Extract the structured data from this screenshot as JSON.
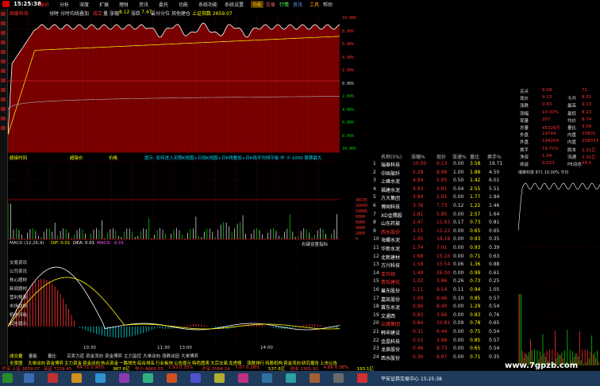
{
  "window": {
    "clock": "15:25:38"
  },
  "menu": [
    {
      "label": "报价",
      "active": true
    },
    {
      "label": "分析",
      "active": false
    },
    {
      "label": "深度",
      "active": false
    },
    {
      "label": "扩展",
      "active": false
    },
    {
      "label": "理财",
      "active": false
    },
    {
      "label": "资讯",
      "active": false
    },
    {
      "label": "委托",
      "active": false
    },
    {
      "label": "功能",
      "active": false
    },
    {
      "label": "系统功能",
      "active": false
    },
    {
      "label": "系统设置",
      "active": false
    }
  ],
  "sys_links": [
    {
      "label": "功能",
      "color": "#ffcc00"
    },
    {
      "label": "交易",
      "color": "#ff6060"
    },
    {
      "label": "行情",
      "color": "#60ff60"
    },
    {
      "label": "资讯",
      "color": "#60a0ff"
    },
    {
      "label": "工具",
      "color": "#ff9900"
    },
    {
      "label": "帮助",
      "color": "#cccccc"
    }
  ],
  "top_header": {
    "stock_name": "国泰科技",
    "fenshi": "分时",
    "tab1": "分时均线叠加",
    "price": "成交",
    "vol": "量",
    "chg": "涨幅",
    "index": "8.12",
    "zhangdie": "涨跌",
    "zd_val": "7.47",
    "state": "最分分位",
    "other": "其他建仓",
    "ref": "上证指数 2659.07"
  },
  "price_axis_right": [
    "10.00%",
    "8.00%",
    "6.00%",
    "4.00%",
    "2.00%",
    "0.00%",
    "2.00%",
    "4.00%",
    "6.00%",
    "8.00%",
    "10.00%"
  ],
  "indicator_header": {
    "a": "超级时间",
    "b": "超级价",
    "c": "价格",
    "d": "提示: 如何进入无限K线图+日线K线图+日K线叠加+日K线平均线平板 中 小 1000 股票最大"
  },
  "vol_axis": [
    "30135",
    "20099",
    "10066",
    "8000",
    "6000",
    "4000",
    "2000",
    "0"
  ],
  "macd_header": {
    "label": "MACD (12,26,9)",
    "dif": "DIF: 0.01",
    "dea": "DEA: 0.01",
    "macd": "MACD: -0.01"
  },
  "right_note": "右键设置指标",
  "left_labels": [
    "交易资讯",
    "公司资讯",
    "核心题材",
    "新闻题材",
    "营利预测",
    "市场结构",
    "机构评级",
    "公告提示"
  ],
  "time_axis": [
    "10:30",
    "11:30",
    "13:00",
    "14:00"
  ],
  "table": {
    "headers": [
      "名称(5%)",
      "涨幅%",
      "现价",
      "涨速%",
      "量比",
      "换手%"
    ],
    "rows": [
      {
        "no": "1",
        "name": "瑞泰科技",
        "chg": "10.00",
        "price": "9.13",
        "speed": "0.00",
        "ratio": "3.58",
        "turn": "19.71",
        "up": true
      },
      {
        "no": "2",
        "name": "中国玻纤",
        "chg": "5.28",
        "price": "8.98",
        "speed": "1.00",
        "ratio": "1.88",
        "turn": "4.50",
        "up": true
      },
      {
        "no": "3",
        "name": "上峰水泥",
        "chg": "4.94",
        "price": "5.95",
        "speed": "0.50",
        "ratio": "1.42",
        "turn": "6.01",
        "up": true
      },
      {
        "no": "4",
        "name": "福建水泥",
        "chg": "4.93",
        "price": "5.81",
        "speed": "0.04",
        "ratio": "2.55",
        "turn": "5.51",
        "up": true
      },
      {
        "no": "5",
        "name": "方大集团",
        "chg": "3.94",
        "price": "2.91",
        "speed": "0.00",
        "ratio": "1.77",
        "turn": "1.94",
        "up": true
      },
      {
        "no": "6",
        "name": "博闻科技",
        "chg": "3.76",
        "price": "7.73",
        "speed": "0.12",
        "ratio": "1.22",
        "turn": "1.46",
        "up": true
      },
      {
        "no": "7",
        "name": "XD金隅股",
        "chg": "2.81",
        "price": "5.85",
        "speed": "0.00",
        "ratio": "2.57",
        "turn": "1.64",
        "up": true
      },
      {
        "no": "8",
        "name": "山东药玻",
        "chg": "2.47",
        "price": "11.63",
        "speed": "0.17",
        "ratio": "0.73",
        "turn": "0.81",
        "up": true
      },
      {
        "no": "9",
        "name": "西水股份",
        "chg": "2.15",
        "price": "15.22",
        "speed": "0.00",
        "ratio": "0.65",
        "turn": "0.65",
        "up": true
      },
      {
        "no": "10",
        "name": "海螺水泥",
        "chg": "1.95",
        "price": "16.18",
        "speed": "0.00",
        "ratio": "0.93",
        "turn": "0.35",
        "up": true
      },
      {
        "no": "11",
        "name": "华新水泥",
        "chg": "1.74",
        "price": "7.01",
        "speed": "0.00",
        "ratio": "0.93",
        "turn": "0.39",
        "up": true
      },
      {
        "no": "12",
        "name": "北新建材",
        "chg": "1.68",
        "price": "15.16",
        "speed": "0.00",
        "ratio": "0.71",
        "turn": "0.63",
        "up": true
      },
      {
        "no": "13",
        "name": "方兴科技",
        "chg": "1.58",
        "price": "15.54",
        "speed": "0.06",
        "ratio": "1.36",
        "turn": "0.88",
        "up": true
      },
      {
        "no": "14",
        "name": "亚玛顿",
        "chg": "1.49",
        "price": "26.00",
        "speed": "0.00",
        "ratio": "0.99",
        "turn": "0.61",
        "up": true
      },
      {
        "no": "15",
        "name": "青松建化",
        "chg": "1.32",
        "price": "3.86",
        "speed": "0.26",
        "ratio": "0.73",
        "turn": "0.25",
        "up": true
      },
      {
        "no": "16",
        "name": "巢东股份",
        "chg": "1.11",
        "price": "9.14",
        "speed": "0.11",
        "ratio": "0.94",
        "turn": "1.05",
        "up": true
      },
      {
        "no": "17",
        "name": "嘉凯股份",
        "chg": "1.09",
        "price": "9.46",
        "speed": "0.10",
        "ratio": "0.85",
        "turn": "0.57",
        "up": true
      },
      {
        "no": "18",
        "name": "冀东水泥",
        "chg": "0.96",
        "price": "8.40",
        "speed": "0.00",
        "ratio": "1.29",
        "turn": "0.54",
        "up": true
      },
      {
        "no": "19",
        "name": "文通西",
        "chg": "0.83",
        "price": "3.66",
        "speed": "0.00",
        "ratio": "0.83",
        "turn": "0.76",
        "up": true
      },
      {
        "no": "20",
        "name": "尖峰集团",
        "chg": "0.84",
        "price": "10.81",
        "speed": "0.09",
        "ratio": "0.78",
        "turn": "0.65",
        "up": true
      },
      {
        "no": "21",
        "name": "韩申建设",
        "chg": "0.31",
        "price": "6.44",
        "speed": "0.00",
        "ratio": "0.75",
        "turn": "0.54",
        "up": true
      },
      {
        "no": "22",
        "name": "金晶科技",
        "chg": "0.51",
        "price": "3.98",
        "speed": "0.00",
        "ratio": "0.85",
        "turn": "0.57",
        "up": true
      },
      {
        "no": "23",
        "name": "龙泉股份",
        "chg": "0.46",
        "price": "8.73",
        "speed": "0.00",
        "ratio": "0.65",
        "turn": "0.54",
        "up": true
      },
      {
        "no": "24",
        "name": "西水股份",
        "chg": "0.36",
        "price": "6.97",
        "speed": "0.00",
        "ratio": "0.71",
        "turn": "0.35",
        "up": true
      }
    ]
  },
  "quote": {
    "rows": [
      {
        "l": "买点",
        "m": "9.09",
        "r": "71"
      },
      {
        "l": "现价",
        "m": "9.13",
        "lab2": "今开",
        "r": "8.31"
      },
      {
        "l": "涨跌",
        "m": "0.83",
        "lab2": "最高",
        "r": "9.13"
      },
      {
        "l": "涨幅",
        "m": "10.00%",
        "lab2": "最低",
        "r": "8.13"
      },
      {
        "l": "现量",
        "m": "267",
        "lab2": "均价",
        "r": "8.74"
      },
      {
        "l": "总量",
        "m": "45328万",
        "lab2": "量比",
        "r": "3.58"
      },
      {
        "l": "外盘",
        "m": "19744",
        "lab2": "内盘",
        "r": "25801"
      },
      {
        "l": "外盘",
        "m": "194204",
        "lab2": "内盘",
        "r": "258033"
      },
      {
        "l": "换手",
        "m": "19.71%",
        "lab2": "股本",
        "r": "2.31亿"
      },
      {
        "l": "净资",
        "m": "1.94",
        "lab2": "流通",
        "r": "2.31亿"
      },
      {
        "l": "收益",
        "m": "0.023",
        "lab2": "PE动态",
        "r": "99.5"
      }
    ],
    "mini_title": "瑞泰科技 871 10.00% 今日"
  },
  "sub_tabs": [
    "成交量",
    "量能",
    "量比",
    "买卖力道",
    "资金流向",
    "资金博弈",
    "主力监控",
    "大单动向",
    "涨跌动因",
    "大单博弈"
  ],
  "tab_strip": [
    "全景图",
    "大单动向",
    "资金博弈",
    "主力资金",
    "资金动向",
    "热点资金",
    "一路领先",
    "综合排名",
    "行业板块",
    "公告提示",
    "特色图表",
    "大宗交易",
    "龙虎榜",
    "涨跌排行",
    "持股机构",
    "资金流向",
    "研究报告",
    "上市公告"
  ],
  "status": [
    {
      "t": "沪深 上证 2659.07",
      "c": "#ff4040"
    },
    {
      "t": "深证 7259.45",
      "c": "#ff4040"
    },
    {
      "t": "64.71 0.90%",
      "c": "#ff4040"
    },
    {
      "t": "987.6亿",
      "c": "#ffff00"
    },
    {
      "t": "中小 4669.03",
      "c": "#ff4040"
    },
    {
      "t": "1.93 0.35%",
      "c": "#ff4040"
    },
    {
      "t": "沪深 2584.14",
      "c": "#ff4040"
    },
    {
      "t": "7.07 0.28%",
      "c": "#ff4040"
    },
    {
      "t": "537.6亿",
      "c": "#ffff00"
    },
    {
      "t": "创业 1305.92",
      "c": "#ff4040"
    },
    {
      "t": "4.89 0.38%",
      "c": "#ff4040"
    },
    {
      "t": "193.1亿",
      "c": "#ffff00"
    }
  ],
  "taskbar_right": "平安证券交易中心  15:25:38",
  "watermark": "www.7gpzb.com",
  "colors": {
    "up": "#ff3030",
    "down": "#00d000",
    "grid": "#6b0000",
    "fill": "#8b0000"
  }
}
